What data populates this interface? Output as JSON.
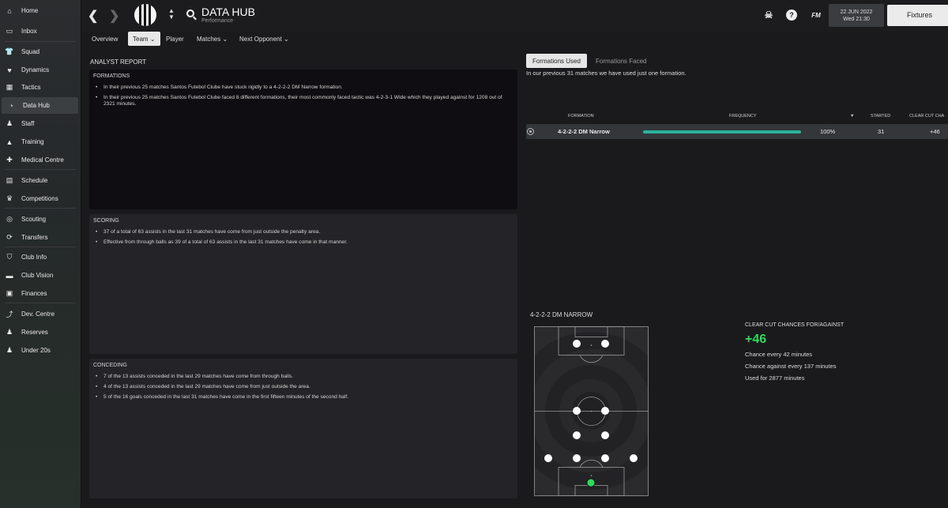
{
  "sidebar": {
    "items": [
      {
        "label": "Home",
        "icon": "home-icon"
      },
      {
        "label": "Inbox",
        "icon": "inbox-icon"
      },
      {
        "label": "Squad",
        "icon": "shirt-icon"
      },
      {
        "label": "Dynamics",
        "icon": "dynamics-icon"
      },
      {
        "label": "Tactics",
        "icon": "tactics-icon"
      },
      {
        "label": "Data Hub",
        "icon": "data-hub-icon"
      },
      {
        "label": "Staff",
        "icon": "staff-icon"
      },
      {
        "label": "Training",
        "icon": "training-icon"
      },
      {
        "label": "Medical Centre",
        "icon": "medical-icon"
      },
      {
        "label": "Schedule",
        "icon": "calendar-icon"
      },
      {
        "label": "Competitions",
        "icon": "trophy-icon"
      },
      {
        "label": "Scouting",
        "icon": "scouting-icon"
      },
      {
        "label": "Transfers",
        "icon": "transfers-icon"
      },
      {
        "label": "Club Info",
        "icon": "shield-icon"
      },
      {
        "label": "Club Vision",
        "icon": "vision-icon"
      },
      {
        "label": "Finances",
        "icon": "finances-icon"
      },
      {
        "label": "Dev. Centre",
        "icon": "dev-centre-icon"
      },
      {
        "label": "Reserves",
        "icon": "reserves-icon"
      },
      {
        "label": "Under 20s",
        "icon": "under-20s-icon"
      }
    ],
    "active": "Data Hub"
  },
  "header": {
    "title": "DATA HUB",
    "subtitle": "Performance",
    "date": "22 JUN 2022",
    "time": "Wed 21:30",
    "fixtures_label": "Fixtures",
    "fm_label": "FM",
    "help_label": "?"
  },
  "tabs": [
    {
      "label": "Overview"
    },
    {
      "label": "Team ⌄"
    },
    {
      "label": "Player"
    },
    {
      "label": "Matches ⌄"
    },
    {
      "label": "Next Opponent ⌄"
    }
  ],
  "report": {
    "heading": "ANALYST REPORT",
    "formations": {
      "title": "FORMATIONS",
      "bullets": [
        "In their previous 25 matches Santos Futebol Clube have stuck rigidly to a 4-2-2-2 DM Narrow formation.",
        "In their previous 25 matches Santos Futebol Clube faced 8 different formations, their most commonly faced tactic was 4-2-3-1 Wide which they played against for 1208 out of 2321 minutes."
      ]
    },
    "scoring": {
      "title": "SCORING",
      "bullets": [
        "37 of a total of 63 assists in the last 31 matches have come from just outside the penalty area.",
        "Effective from through balls as 39 of a total of 63 assists in the last 31 matches have come in that manner."
      ]
    },
    "conceding": {
      "title": "CONCEDING",
      "bullets": [
        "7 of the 13 assists conceded in the last 29 matches have come from through balls.",
        "4 of the 13 assists conceded in the last 29 matches have come from just outside the area.",
        "5 of the 16 goals conceded in the last 31 matches have come in the first fifteen minutes of the second half."
      ]
    }
  },
  "formations_panel": {
    "tabs": {
      "used": "Formations Used",
      "faced": "Formations Faced"
    },
    "summary": "In our previous 31 matches we have used just one formation.",
    "columns": {
      "formation": "FORMATION",
      "frequency": "FREQUENCY",
      "started": "STARTED",
      "clear_cut": "CLEAR CUT CHA"
    },
    "rows": [
      {
        "formation": "4-2-2-2 DM Narrow",
        "frequency": 1.0,
        "frequency_label": "100%",
        "started": "31",
        "clear_cut": "+46"
      }
    ],
    "bar_color": "#2bb39c"
  },
  "pitch": {
    "title": "4-2-2-2 DM NARROW",
    "goalkeeper_color": "#2fdc5a"
  },
  "clear_cut": {
    "heading": "CLEAR CUT CHANCES FOR/AGAINST",
    "value": "+46",
    "value_color": "#2fdc5a",
    "chance_every": "Chance every 42 minutes",
    "against_every": "Chance against every 137 minutes",
    "used_for": "Used for 2877 minutes"
  }
}
